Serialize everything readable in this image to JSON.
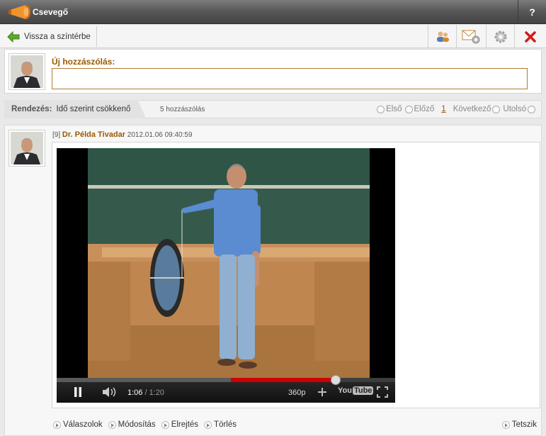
{
  "header": {
    "title": "Csevegő",
    "help_label": "?"
  },
  "toolbar": {
    "back_label": "Vissza a színtérbe",
    "icons": [
      "users-icon",
      "mail-settings-icon",
      "gear-icon",
      "close-icon"
    ]
  },
  "composer": {
    "label": "Új hozzászólás:",
    "value": ""
  },
  "sortbar": {
    "label": "Rendezés:",
    "value": "Idő szerint csökkenő",
    "count": "5 hozzászólás",
    "pager": {
      "first": "Első",
      "prev": "Előző",
      "current": "1",
      "next": "Következő",
      "last": "Utolsó"
    }
  },
  "post": {
    "index": "[9]",
    "author": "Dr. Példa Tivadar",
    "timestamp": "2012.01.06 09:40:59",
    "video": {
      "time_current": "1:06",
      "time_separator": "/",
      "time_total": "1:20",
      "quality": "360p",
      "brand": "YouTube",
      "progress_fraction": 0.825,
      "buffered_fraction": 0.515
    },
    "actions": [
      "Válaszolok",
      "Módosítás",
      "Elrejtés",
      "Törlés"
    ],
    "like_label": "Tetszik"
  },
  "colors": {
    "accent": "#9a5a00",
    "titlebar": "#565656",
    "progress": "#cc0000"
  }
}
